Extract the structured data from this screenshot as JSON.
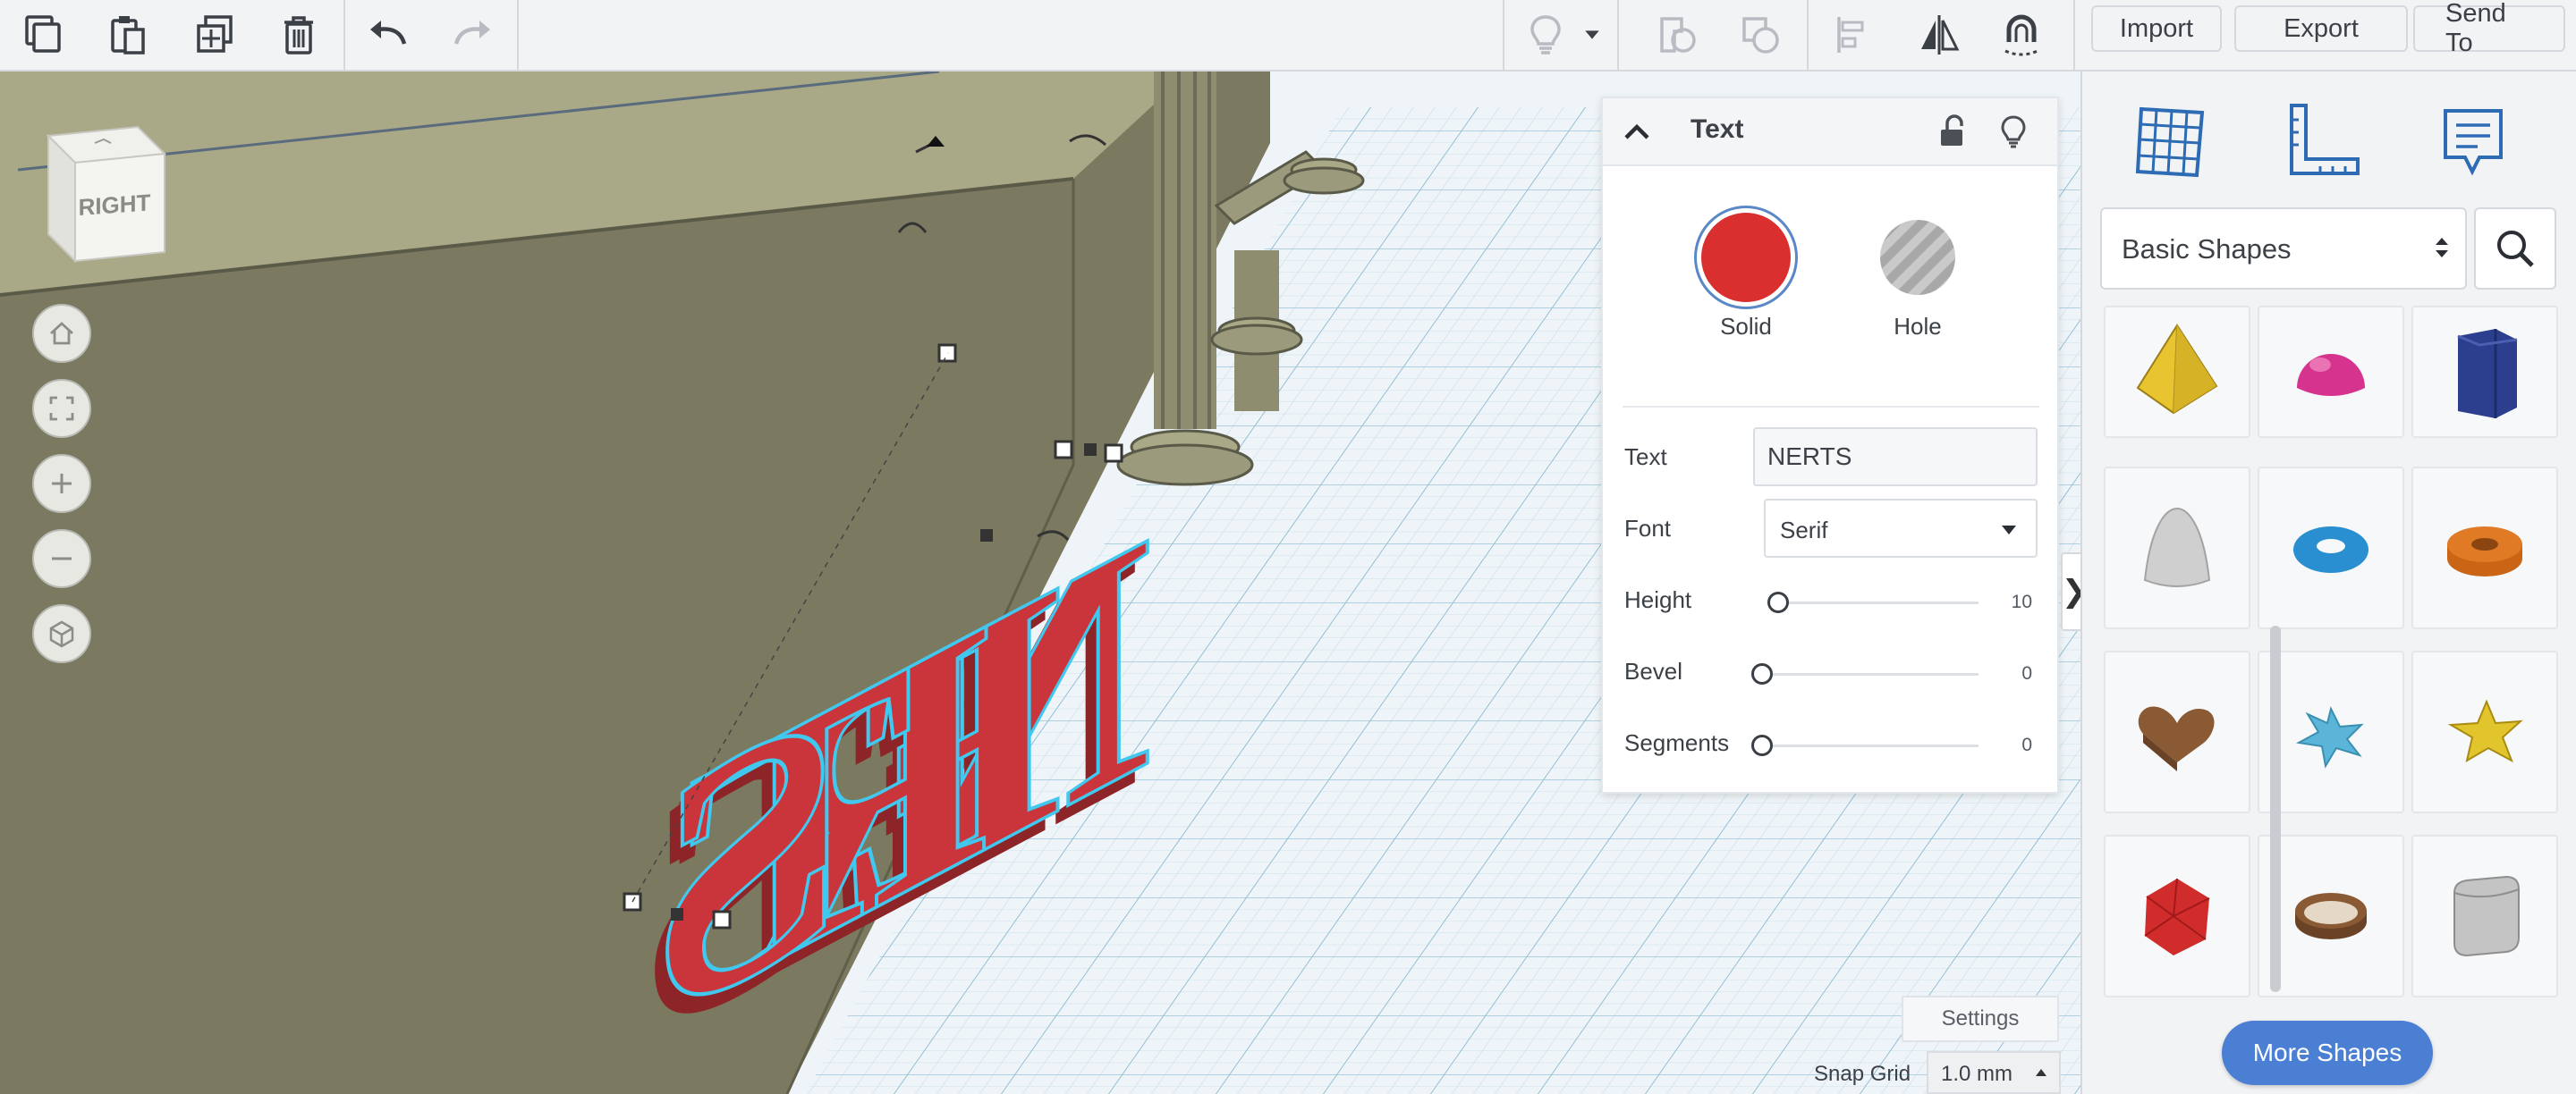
{
  "toolbar": {
    "left_tools": [
      {
        "icon": "copy-icon"
      },
      {
        "icon": "paste-icon"
      },
      {
        "icon": "duplicate-icon"
      },
      {
        "icon": "delete-icon"
      },
      {
        "icon": "undo-icon"
      },
      {
        "icon": "redo-icon"
      }
    ],
    "right_tools": [
      {
        "icon": "bulb-icon"
      },
      {
        "icon": "chevron-down-icon"
      },
      {
        "icon": "group-icon"
      },
      {
        "icon": "ungroup-icon"
      },
      {
        "icon": "align-icon"
      },
      {
        "icon": "mirror-icon"
      },
      {
        "icon": "cruise-icon"
      }
    ],
    "import_label": "Import",
    "export_label": "Export",
    "send_to_label": "Send To"
  },
  "viewport": {
    "view_cube_label": "RIGHT",
    "controls": [
      {
        "icon": "home-icon"
      },
      {
        "icon": "fit-view-icon"
      },
      {
        "icon": "zoom-in-icon"
      },
      {
        "icon": "zoom-out-icon"
      },
      {
        "icon": "perspective-icon"
      }
    ],
    "colors": {
      "wall": "#7b7a61",
      "floor": "#eef4f7",
      "grid_line": "#b7d4e6",
      "text_shape": "#c9353b",
      "selection": "#41c8ef"
    }
  },
  "inspector": {
    "title": "Text",
    "solid_label": "Solid",
    "hole_label": "Hole",
    "solid_color": "#d92f2f",
    "text_label": "Text",
    "text_value": "NERTS",
    "font_label": "Font",
    "font_value": "Serif",
    "height_label": "Height",
    "height_value": "10",
    "bevel_label": "Bevel",
    "bevel_value": "0",
    "segments_label": "Segments",
    "segments_value": "0"
  },
  "right_panel": {
    "tabs": [
      {
        "icon": "workplane-icon"
      },
      {
        "icon": "ruler-icon"
      },
      {
        "icon": "notes-icon"
      }
    ],
    "library_select": "Basic Shapes",
    "shapes": [
      {
        "icon": "pyramid-icon",
        "color": "#e8c431"
      },
      {
        "icon": "half-sphere-icon",
        "color": "#d6338f"
      },
      {
        "icon": "polygon-icon",
        "color": "#2b3f8e"
      },
      {
        "icon": "paraboloid-icon",
        "color": "#cfcfcf"
      },
      {
        "icon": "torus-icon",
        "color": "#2a8fd0"
      },
      {
        "icon": "tube-icon",
        "color": "#e07a25"
      },
      {
        "icon": "heart-icon",
        "color": "#8a5a35"
      },
      {
        "icon": "star-six-icon",
        "color": "#5ab5d8"
      },
      {
        "icon": "star-icon",
        "color": "#e2c42d"
      },
      {
        "icon": "icosahedron-icon",
        "color": "#d12c2c"
      },
      {
        "icon": "ring-icon",
        "color": "#8a5a35"
      },
      {
        "icon": "rounded-box-icon",
        "color": "#c4c4c4"
      }
    ],
    "more_shapes_label": "More Shapes"
  },
  "bottom": {
    "settings_label": "Settings",
    "snap_grid_label": "Snap Grid",
    "snap_grid_value": "1.0 mm"
  }
}
